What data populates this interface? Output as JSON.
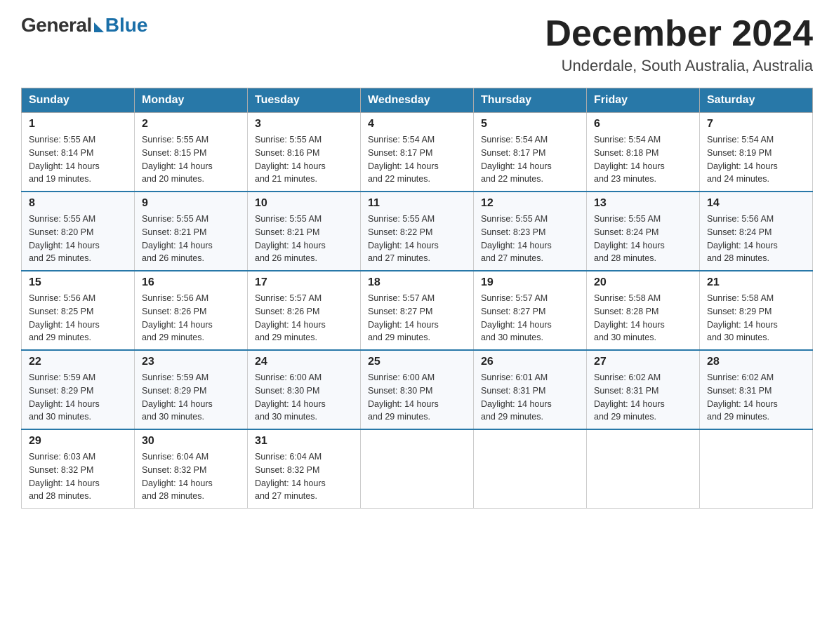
{
  "header": {
    "logo": {
      "general": "General",
      "blue": "Blue"
    },
    "month_title": "December 2024",
    "location": "Underdale, South Australia, Australia"
  },
  "weekdays": [
    "Sunday",
    "Monday",
    "Tuesday",
    "Wednesday",
    "Thursday",
    "Friday",
    "Saturday"
  ],
  "weeks": [
    [
      {
        "day": "1",
        "sunrise": "5:55 AM",
        "sunset": "8:14 PM",
        "daylight": "14 hours and 19 minutes."
      },
      {
        "day": "2",
        "sunrise": "5:55 AM",
        "sunset": "8:15 PM",
        "daylight": "14 hours and 20 minutes."
      },
      {
        "day": "3",
        "sunrise": "5:55 AM",
        "sunset": "8:16 PM",
        "daylight": "14 hours and 21 minutes."
      },
      {
        "day": "4",
        "sunrise": "5:54 AM",
        "sunset": "8:17 PM",
        "daylight": "14 hours and 22 minutes."
      },
      {
        "day": "5",
        "sunrise": "5:54 AM",
        "sunset": "8:17 PM",
        "daylight": "14 hours and 22 minutes."
      },
      {
        "day": "6",
        "sunrise": "5:54 AM",
        "sunset": "8:18 PM",
        "daylight": "14 hours and 23 minutes."
      },
      {
        "day": "7",
        "sunrise": "5:54 AM",
        "sunset": "8:19 PM",
        "daylight": "14 hours and 24 minutes."
      }
    ],
    [
      {
        "day": "8",
        "sunrise": "5:55 AM",
        "sunset": "8:20 PM",
        "daylight": "14 hours and 25 minutes."
      },
      {
        "day": "9",
        "sunrise": "5:55 AM",
        "sunset": "8:21 PM",
        "daylight": "14 hours and 26 minutes."
      },
      {
        "day": "10",
        "sunrise": "5:55 AM",
        "sunset": "8:21 PM",
        "daylight": "14 hours and 26 minutes."
      },
      {
        "day": "11",
        "sunrise": "5:55 AM",
        "sunset": "8:22 PM",
        "daylight": "14 hours and 27 minutes."
      },
      {
        "day": "12",
        "sunrise": "5:55 AM",
        "sunset": "8:23 PM",
        "daylight": "14 hours and 27 minutes."
      },
      {
        "day": "13",
        "sunrise": "5:55 AM",
        "sunset": "8:24 PM",
        "daylight": "14 hours and 28 minutes."
      },
      {
        "day": "14",
        "sunrise": "5:56 AM",
        "sunset": "8:24 PM",
        "daylight": "14 hours and 28 minutes."
      }
    ],
    [
      {
        "day": "15",
        "sunrise": "5:56 AM",
        "sunset": "8:25 PM",
        "daylight": "14 hours and 29 minutes."
      },
      {
        "day": "16",
        "sunrise": "5:56 AM",
        "sunset": "8:26 PM",
        "daylight": "14 hours and 29 minutes."
      },
      {
        "day": "17",
        "sunrise": "5:57 AM",
        "sunset": "8:26 PM",
        "daylight": "14 hours and 29 minutes."
      },
      {
        "day": "18",
        "sunrise": "5:57 AM",
        "sunset": "8:27 PM",
        "daylight": "14 hours and 29 minutes."
      },
      {
        "day": "19",
        "sunrise": "5:57 AM",
        "sunset": "8:27 PM",
        "daylight": "14 hours and 30 minutes."
      },
      {
        "day": "20",
        "sunrise": "5:58 AM",
        "sunset": "8:28 PM",
        "daylight": "14 hours and 30 minutes."
      },
      {
        "day": "21",
        "sunrise": "5:58 AM",
        "sunset": "8:29 PM",
        "daylight": "14 hours and 30 minutes."
      }
    ],
    [
      {
        "day": "22",
        "sunrise": "5:59 AM",
        "sunset": "8:29 PM",
        "daylight": "14 hours and 30 minutes."
      },
      {
        "day": "23",
        "sunrise": "5:59 AM",
        "sunset": "8:29 PM",
        "daylight": "14 hours and 30 minutes."
      },
      {
        "day": "24",
        "sunrise": "6:00 AM",
        "sunset": "8:30 PM",
        "daylight": "14 hours and 30 minutes."
      },
      {
        "day": "25",
        "sunrise": "6:00 AM",
        "sunset": "8:30 PM",
        "daylight": "14 hours and 29 minutes."
      },
      {
        "day": "26",
        "sunrise": "6:01 AM",
        "sunset": "8:31 PM",
        "daylight": "14 hours and 29 minutes."
      },
      {
        "day": "27",
        "sunrise": "6:02 AM",
        "sunset": "8:31 PM",
        "daylight": "14 hours and 29 minutes."
      },
      {
        "day": "28",
        "sunrise": "6:02 AM",
        "sunset": "8:31 PM",
        "daylight": "14 hours and 29 minutes."
      }
    ],
    [
      {
        "day": "29",
        "sunrise": "6:03 AM",
        "sunset": "8:32 PM",
        "daylight": "14 hours and 28 minutes."
      },
      {
        "day": "30",
        "sunrise": "6:04 AM",
        "sunset": "8:32 PM",
        "daylight": "14 hours and 28 minutes."
      },
      {
        "day": "31",
        "sunrise": "6:04 AM",
        "sunset": "8:32 PM",
        "daylight": "14 hours and 27 minutes."
      },
      null,
      null,
      null,
      null
    ]
  ],
  "labels": {
    "sunrise": "Sunrise:",
    "sunset": "Sunset:",
    "daylight": "Daylight:"
  }
}
